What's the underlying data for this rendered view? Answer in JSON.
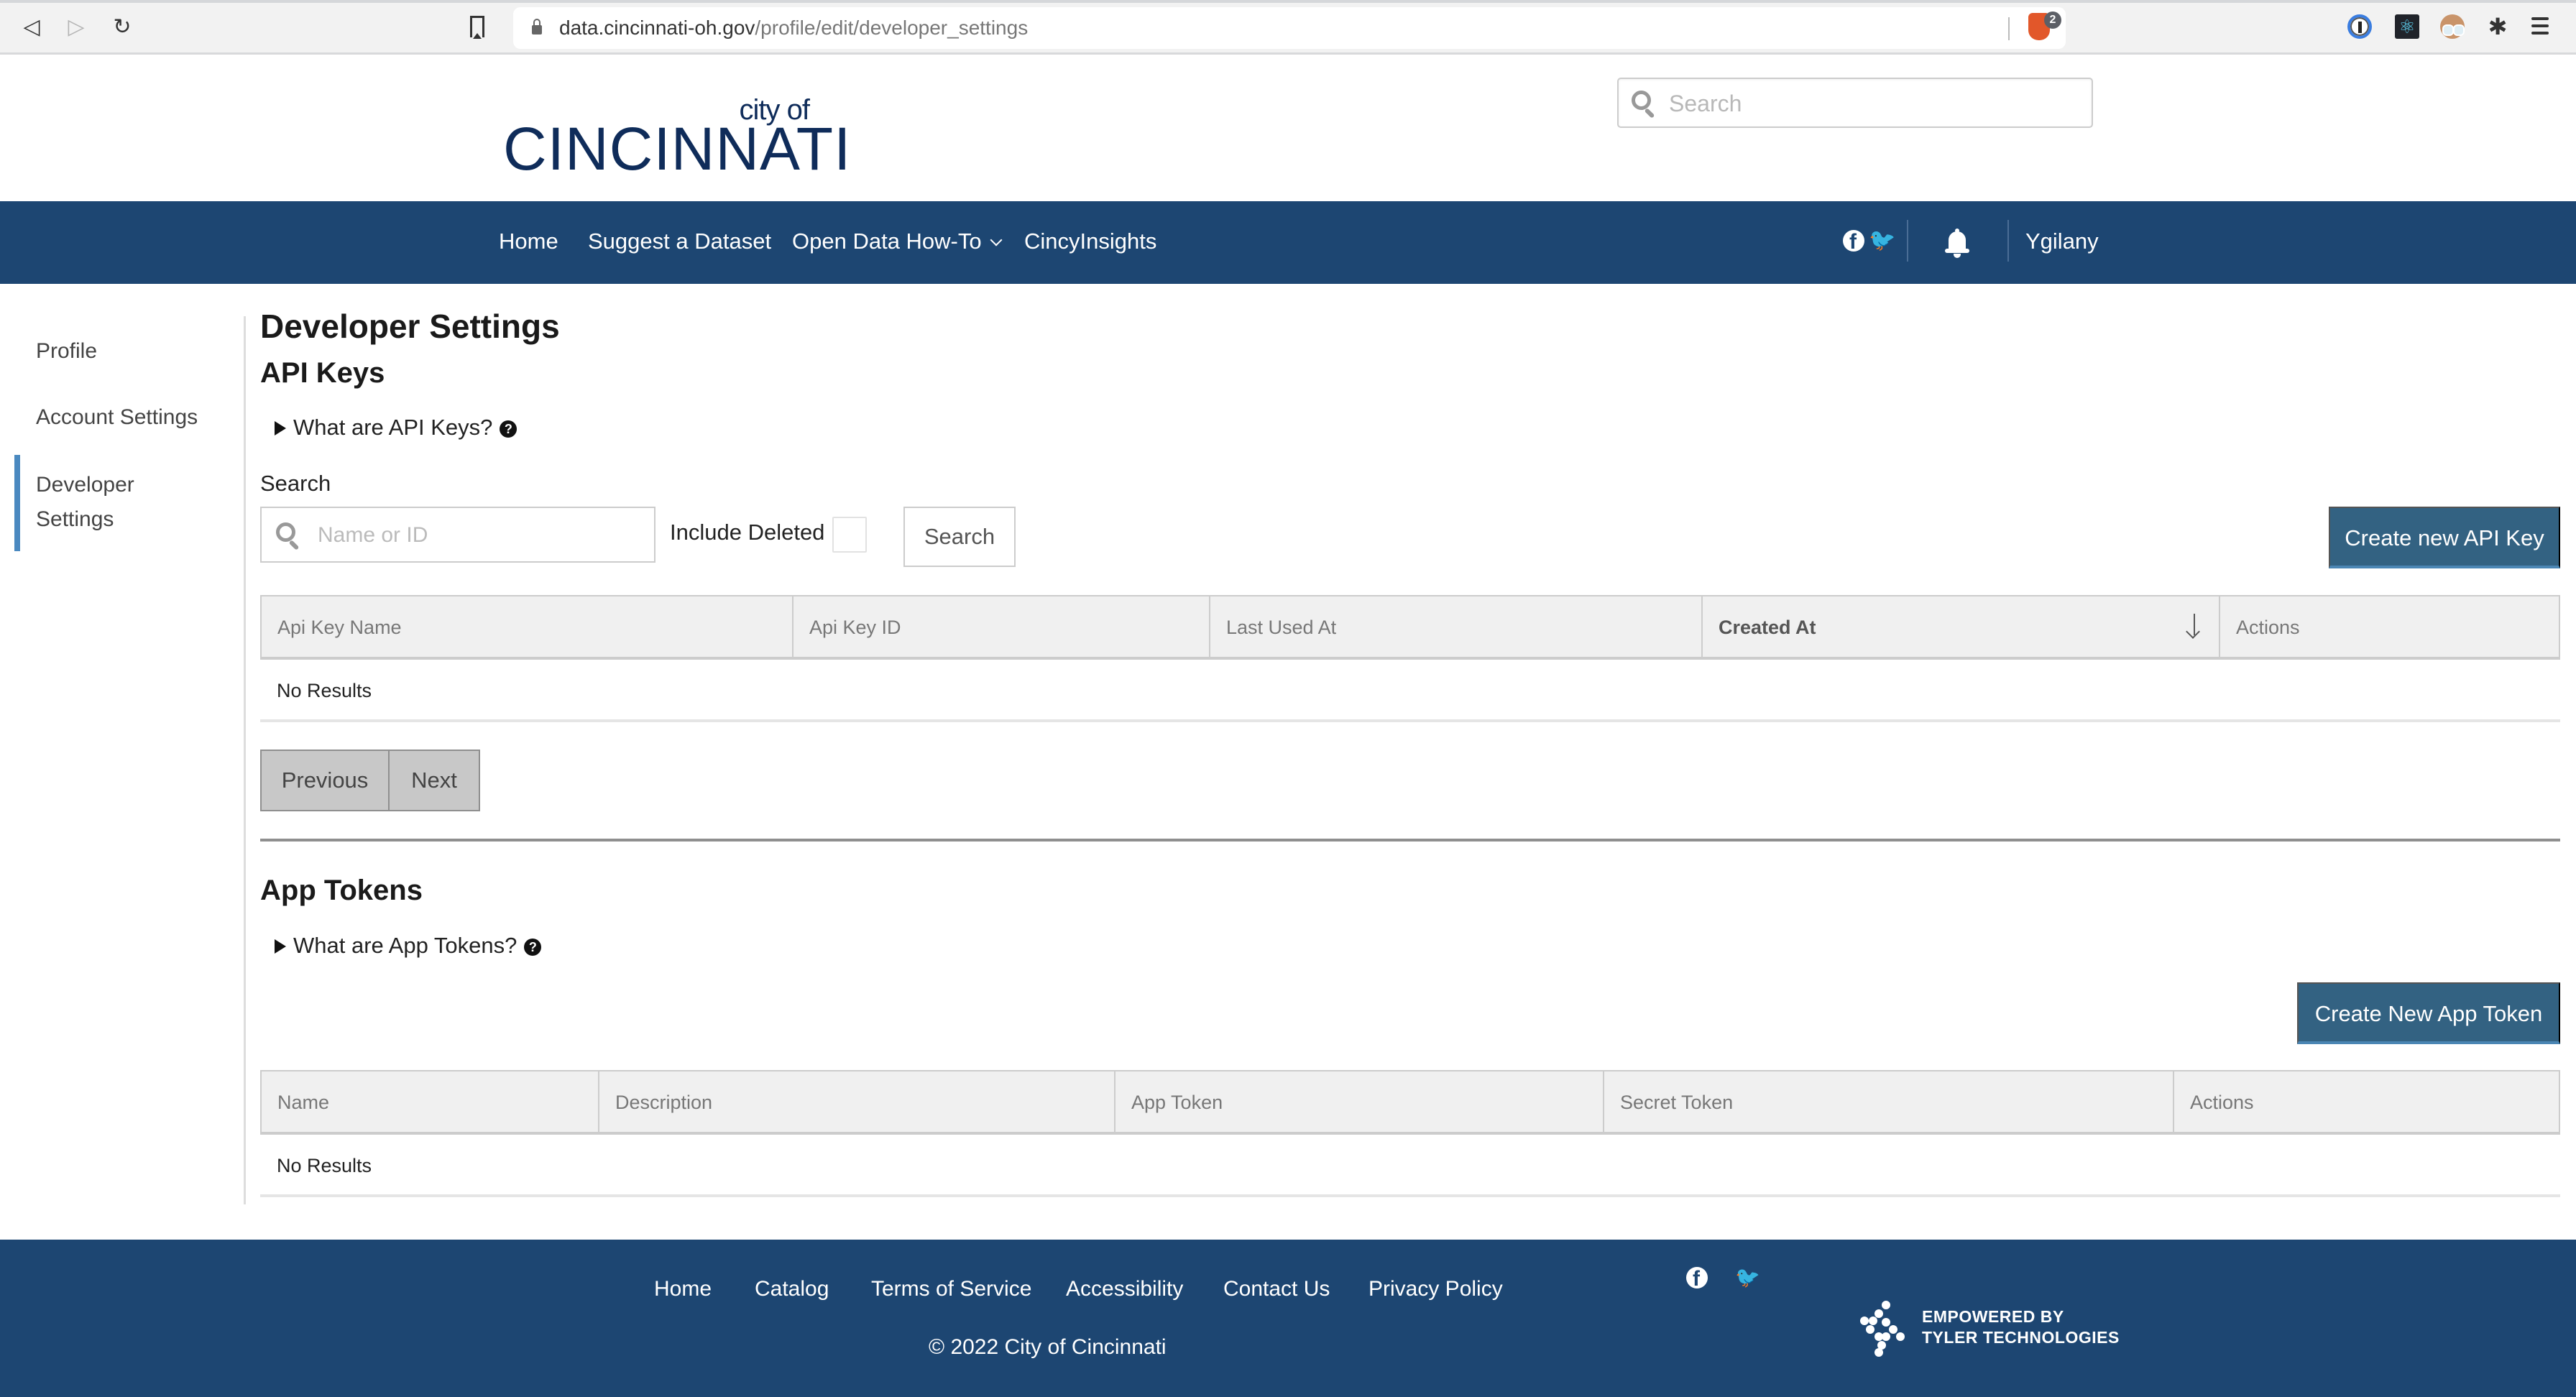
{
  "browser": {
    "url_host": "data.cincinnati-oh.gov",
    "url_path": "/profile/edit/developer_settings",
    "brave_badge_count": "2",
    "icons": [
      "back-icon",
      "forward-icon",
      "reload-icon",
      "bookmark-icon",
      "lock-icon",
      "brave-shield-icon",
      "1password-icon",
      "react-devtools-icon",
      "avatar-extension-icon",
      "extensions-puzzle-icon",
      "menu-icon"
    ]
  },
  "header": {
    "logo_small": "city of",
    "logo_big": "CINCINNATI",
    "search_placeholder": "Search"
  },
  "navbar": {
    "items": [
      {
        "label": "Home"
      },
      {
        "label": "Suggest a Dataset"
      },
      {
        "label": "Open Data How-To",
        "has_dropdown": true
      },
      {
        "label": "CincyInsights"
      }
    ],
    "username": "Ygilany",
    "bg_color": "#1d4672"
  },
  "sidebar": {
    "items": [
      {
        "label": "Profile",
        "active": false
      },
      {
        "label": "Account Settings",
        "active": false
      },
      {
        "label_line1": "Developer",
        "label_line2": "Settings",
        "active": true
      }
    ],
    "active_color": "#4a89c0"
  },
  "main": {
    "title": "Developer Settings",
    "api_keys": {
      "heading": "API Keys",
      "help_toggle": "What are API Keys?",
      "search_label": "Search",
      "search_placeholder": "Name or ID",
      "include_deleted_label": "Include Deleted",
      "include_deleted_checked": false,
      "search_button": "Search",
      "create_button": "Create new API Key",
      "columns": [
        "Api Key Name",
        "Api Key ID",
        "Last Used At",
        "Created At",
        "Actions"
      ],
      "sorted_column": "Created At",
      "sort_direction": "descending",
      "empty_text": "No Results",
      "pager": {
        "previous": "Previous",
        "next": "Next"
      }
    },
    "app_tokens": {
      "heading": "App Tokens",
      "help_toggle": "What are App Tokens?",
      "create_button": "Create New App Token",
      "columns": [
        "Name",
        "Description",
        "App Token",
        "Secret Token",
        "Actions"
      ],
      "empty_text": "No Results"
    },
    "primary_button_color": "#336282"
  },
  "footer": {
    "links": [
      "Home",
      "Catalog",
      "Terms of Service",
      "Accessibility",
      "Contact Us",
      "Privacy Policy"
    ],
    "copyright": "© 2022 City of Cincinnati",
    "powered_line1": "EMPOWERED BY",
    "powered_line2": "TYLER TECHNOLOGIES"
  }
}
